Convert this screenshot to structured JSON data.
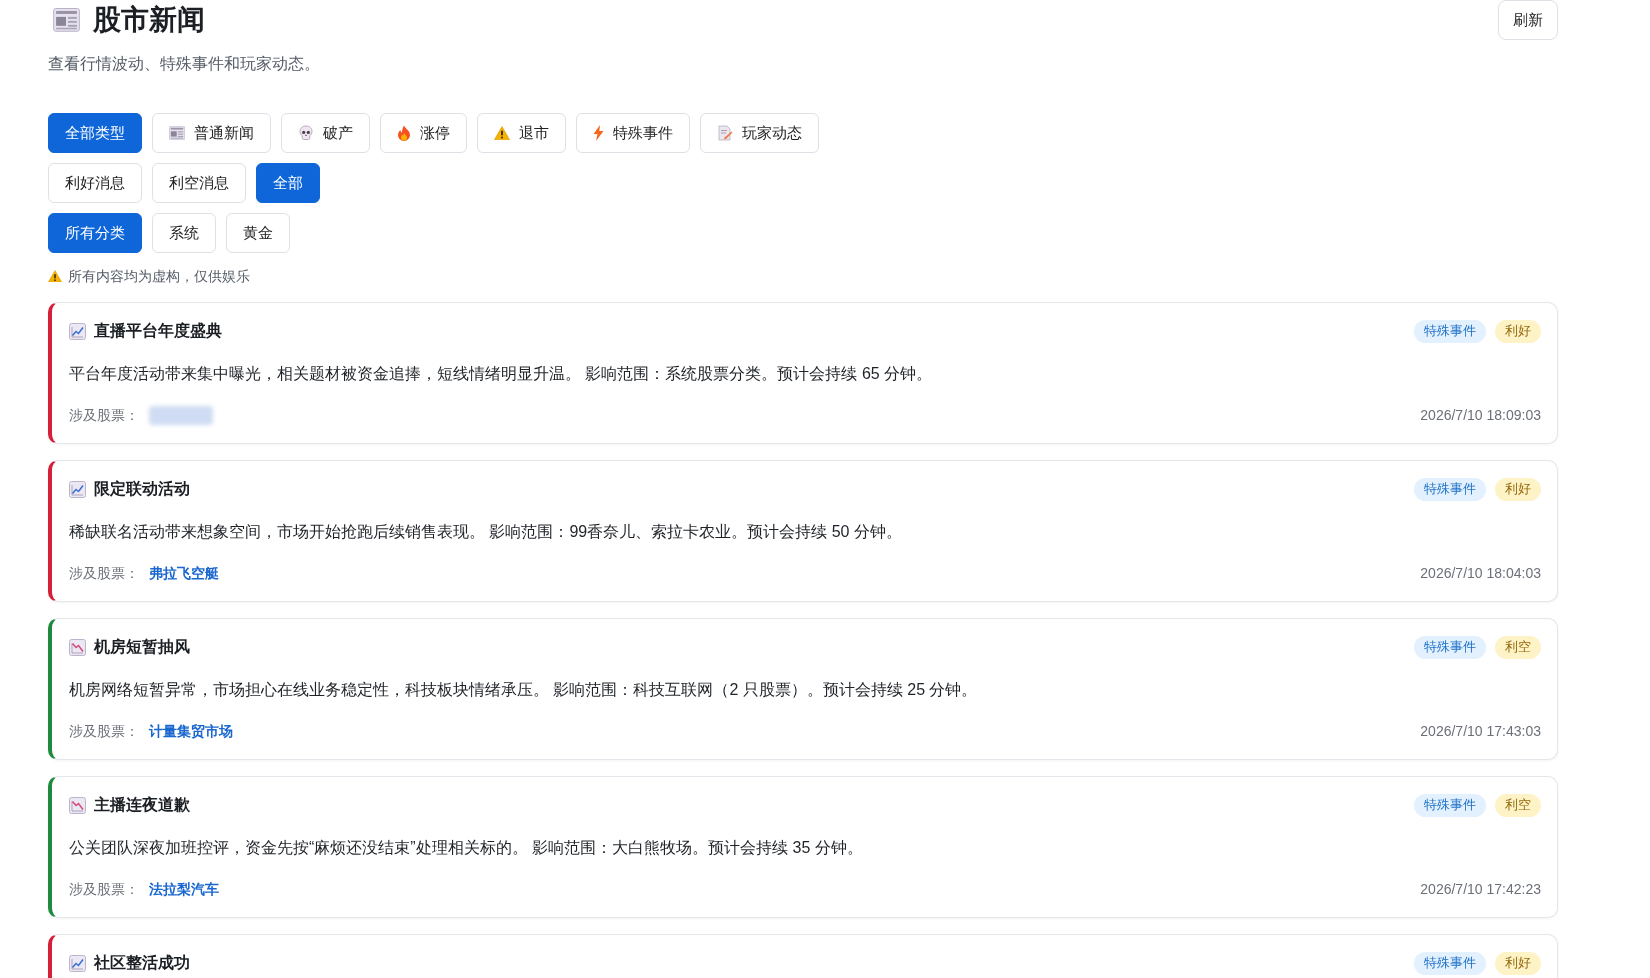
{
  "page": {
    "title": "股市新闻",
    "subtitle": "查看行情波动、特殊事件和玩家动态。",
    "refresh_button": "刷新"
  },
  "type_filters": [
    {
      "label": "全部类型",
      "kind": "all",
      "selected": true
    },
    {
      "label": "普通新闻",
      "kind": "general",
      "selected": false
    },
    {
      "label": "破产",
      "kind": "bankrupt",
      "selected": false
    },
    {
      "label": "涨停",
      "kind": "limit_up",
      "selected": false
    },
    {
      "label": "退市",
      "kind": "delist",
      "selected": false
    },
    {
      "label": "特殊事件",
      "kind": "special",
      "selected": false
    },
    {
      "label": "玩家动态",
      "kind": "player",
      "selected": false
    }
  ],
  "sentiment_filters": [
    {
      "label": "利好消息",
      "selected": false
    },
    {
      "label": "利空消息",
      "selected": false
    },
    {
      "label": "全部",
      "selected": true
    }
  ],
  "category_filters": [
    {
      "label": "所有分类",
      "selected": true
    },
    {
      "label": "系统",
      "selected": false
    },
    {
      "label": "黄金",
      "selected": false
    }
  ],
  "disclaimer": "所有内容均为虚构，仅供娱乐",
  "news": [
    {
      "kind": "up",
      "title": "直播平台年度盛典",
      "tags": [
        {
          "label": "特殊事件",
          "kind": "type"
        },
        {
          "label": "利好",
          "kind": "sentiment"
        }
      ],
      "body": "平台年度活动带来集中曝光，相关题材被资金追捧，短线情绪明显升温。 影响范围：系统股票分类。预计会持续 65 分钟。",
      "stocks_label": "涉及股票：",
      "time": "2026/7/10 18:09:03"
    },
    {
      "kind": "up",
      "title": "限定联动活动",
      "tags": [
        {
          "label": "特殊事件",
          "kind": "type"
        },
        {
          "label": "利好",
          "kind": "sentiment"
        }
      ],
      "body": "稀缺联名活动带来想象空间，市场开始抢跑后续销售表现。 影响范围：99香奈儿、索拉卡农业。预计会持续 50 分钟。",
      "stocks_label": "涉及股票：",
      "stock": "弗拉飞空艇",
      "time": "2026/7/10 18:04:03"
    },
    {
      "kind": "down",
      "title": "机房短暂抽风",
      "tags": [
        {
          "label": "特殊事件",
          "kind": "type"
        },
        {
          "label": "利空",
          "kind": "sentiment"
        }
      ],
      "body": "机房网络短暂异常，市场担心在线业务稳定性，科技板块情绪承压。 影响范围：科技互联网（2 只股票）。预计会持续 25 分钟。",
      "stocks_label": "涉及股票：",
      "stock": "计量集贸市场",
      "time": "2026/7/10 17:43:03"
    },
    {
      "kind": "down",
      "title": "主播连夜道歉",
      "tags": [
        {
          "label": "特殊事件",
          "kind": "type"
        },
        {
          "label": "利空",
          "kind": "sentiment"
        }
      ],
      "body": "公关团队深夜加班控评，资金先按“麻烦还没结束”处理相关标的。 影响范围：大白熊牧场。预计会持续 35 分钟。",
      "stocks_label": "涉及股票：",
      "stock": "法拉梨汽车",
      "time": "2026/7/10 17:42:23"
    },
    {
      "kind": "up",
      "title": "社区整活成功",
      "tags": [
        {
          "label": "特殊事件",
          "kind": "type"
        },
        {
          "label": "利好",
          "kind": "sentiment"
        }
      ]
    }
  ]
}
